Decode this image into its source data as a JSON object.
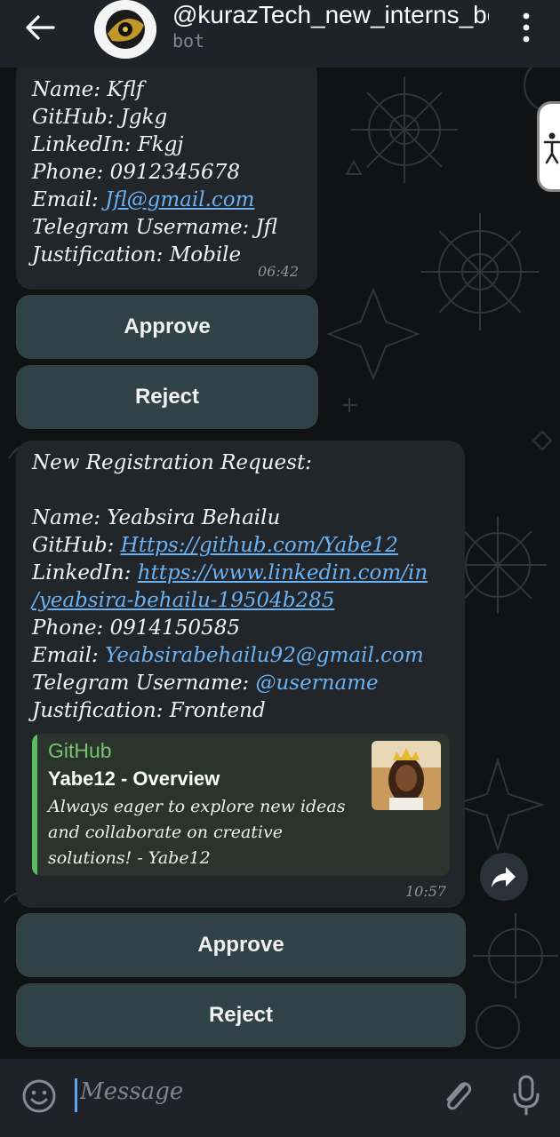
{
  "header": {
    "back_icon": "arrow-left-icon",
    "title": "@kurazTech_new_interns_bot",
    "subtitle": "bot",
    "menu_icon": "more-vertical-icon"
  },
  "messages": [
    {
      "lines": [
        {
          "label": "Name: ",
          "value": "Kflf"
        },
        {
          "label": "GitHub: ",
          "value": "Jgkg"
        },
        {
          "label": "LinkedIn: ",
          "value": "Fkgj"
        },
        {
          "label": "Phone: ",
          "value": "0912345678"
        },
        {
          "label": "Email: ",
          "value": "Jfl@gmail.com"
        },
        {
          "label": "Telegram Username: ",
          "value": "Jfl"
        },
        {
          "label": "Justification: ",
          "value": "Mobile"
        }
      ],
      "time": "06:42",
      "buttons": {
        "approve": "Approve",
        "reject": "Reject"
      }
    },
    {
      "heading": "New Registration Request:",
      "lines": [
        {
          "label": "Name: ",
          "value": "Yeabsira Behailu"
        },
        {
          "label": "GitHub: ",
          "value": "Https://github.com/Yabe12"
        },
        {
          "label": "LinkedIn: ",
          "value": "https://www.linkedin.com/in"
        },
        {
          "label": "",
          "value": "/yeabsira-behailu-19504b285"
        },
        {
          "label": "Phone: ",
          "value": "0914150585"
        },
        {
          "label": "Email: ",
          "value": "Yeabsirabehailu92@gmail.com"
        },
        {
          "label": "Telegram Username: ",
          "value": "@username"
        },
        {
          "label": "Justification: ",
          "value": "Frontend"
        }
      ],
      "preview": {
        "site": "GitHub",
        "title": "Yabe12 - Overview",
        "description": "Always eager to explore new ideas and collaborate on creative solutions! - Yabe12"
      },
      "time": "10:57",
      "buttons": {
        "approve": "Approve",
        "reject": "Reject"
      }
    }
  ],
  "input": {
    "placeholder": "Message",
    "emoji_icon": "emoji-icon",
    "attach_icon": "paperclip-icon",
    "mic_icon": "microphone-icon"
  },
  "colors": {
    "header_bg": "#1f2329",
    "bubble_bg": "#22262b",
    "button_bg": "#33454a",
    "link": "#6ab3f3",
    "preview_accent": "#5cbd5e"
  }
}
